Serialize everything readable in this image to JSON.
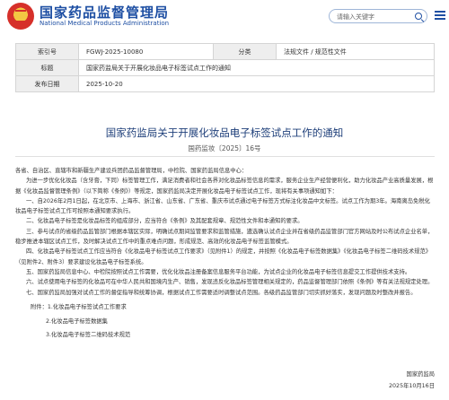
{
  "site": {
    "title": "国家药品监督管理局",
    "subtitle": "National Medical Products Administration"
  },
  "search": {
    "placeholder": "请输入关键字"
  },
  "meta": {
    "index_label": "索引号",
    "index_value": "FGWJ-2025-10080",
    "category_label": "分类",
    "category_value": "法规文件 / 规范性文件",
    "title_label": "标题",
    "title_value": "国家药监局关于开展化妆品电子标签试点工作的通知",
    "date_label": "发布日期",
    "date_value": "2025-10-20"
  },
  "document": {
    "title": "国家药监局关于开展化妆品电子标签试点工作的通知",
    "number": "国药监妆〔2025〕16号",
    "salutation": "各省、自治区、直辖市和新疆生产建设兵团药品监督管理局，中检院、国家药监局信息中心：",
    "paragraphs": [
      "为进一步优化化妆品（含牙膏，下同）标签管理工作，满足消费者和社会各界对化妆品标签信息的需求，服务企业生产经营便利化，助力化妆品产业高质量发展，根据《化妆品监督管理条例》（以下简称《条例》）等规定，国家药监局决定开展化妆品电子标签试点工作，现将有关事项通知如下：",
      "一、自2026年2月1日起，在北京市、上海市、浙江省、山东省、广东省、重庆市试点通过电子标签方式标注化妆品中文标签。试点工作为期3年。海南离岛免税化妆品电子标签试点工作可按照本通知要求执行。",
      "二、化妆品电子标签是化妆品标签的组成部分，应当符合《条例》及其配套规章、规范性文件和本通知的要求。",
      "三、参与试点的省级药品监管部门根据本辖区实际，明确试点期间监管要求和监管措施，遴选确认试点企业并在省级药品监管部门官方网站及时公布试点企业名单，稳步推进本辖区试点工作，及时解决试点工作中的重点难点问题，形成规范、高效的化妆品电子标签监管模式。",
      "四、化妆品电子标签试点工作应当符合《化妆品电子标签试点工作要求》（见附件1）的规定，并按照《化妆品电子标签数据集》《化妆品电子标签二维码技术规范》（见附件2、附件3）要求建设化妆品电子标签系统。",
      "五、国家药监局信息中心、中检院按照试点工作需要，优化化妆品注册备案信息服务平台功能，为试点企业的化妆品电子标签信息提交工作提供技术支持。",
      "六、试点使用电子标签的化妆品可在中华人民共和国境内生产、销售，发现违反化妆品标签管理相关规定的，药品监督管理部门依照《条例》等有关法规规定处理。",
      "七、国家药监局加强对试点工作的督促指导和统筹协调，根据试点工作需要适时调整试点范围。各级药品监管部门切实抓好落实，发现问题及时整改并报告。"
    ],
    "attachments_label": "附件：",
    "attachments": [
      "1.化妆品电子标签试点工作要求",
      "2.化妆品电子标签数据集",
      "3.化妆品电子标签二维码技术规范"
    ],
    "issuer": "国家药监局",
    "issue_date": "2025年10月16日"
  }
}
